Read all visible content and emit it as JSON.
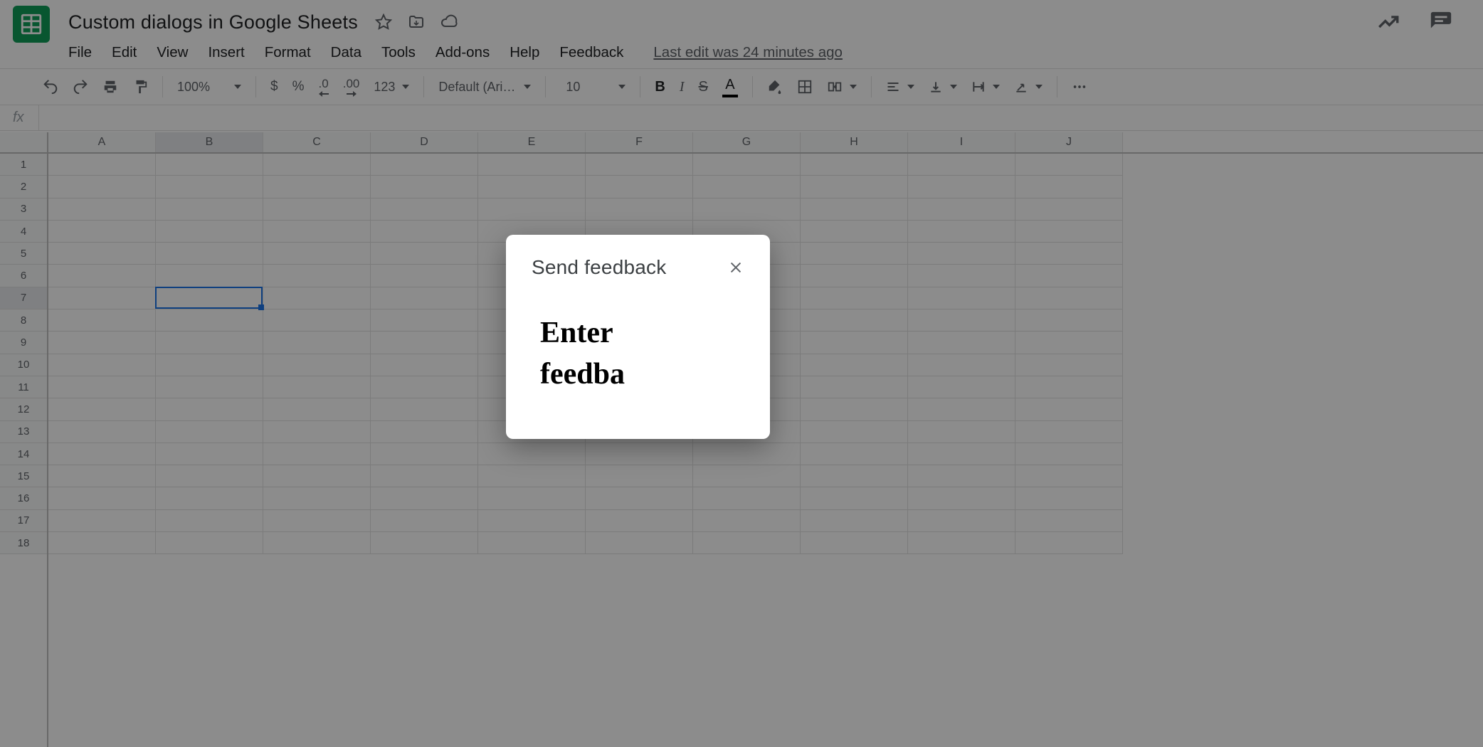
{
  "doc": {
    "title": "Custom dialogs in Google Sheets"
  },
  "menubar": {
    "file": "File",
    "edit": "Edit",
    "view": "View",
    "insert": "Insert",
    "format": "Format",
    "data": "Data",
    "tools": "Tools",
    "addons": "Add-ons",
    "help": "Help",
    "feedback": "Feedback",
    "last_edit": "Last edit was 24 minutes ago"
  },
  "toolbar": {
    "zoom": "100%",
    "currency": "$",
    "percent": "%",
    "dec_less": ".0",
    "dec_more": ".00",
    "num_fmt": "123",
    "font": "Default (Ari…",
    "size": "10"
  },
  "grid": {
    "columns": [
      "A",
      "B",
      "C",
      "D",
      "E",
      "F",
      "G",
      "H",
      "I",
      "J"
    ],
    "rows": [
      "1",
      "2",
      "3",
      "4",
      "5",
      "6",
      "7",
      "8",
      "9",
      "10",
      "11",
      "12",
      "13",
      "14",
      "15",
      "16",
      "17",
      "18"
    ],
    "active_col_index": 1,
    "active_row_index": 6
  },
  "dialog": {
    "title": "Send feedback",
    "prompt": "Enter feedba"
  }
}
